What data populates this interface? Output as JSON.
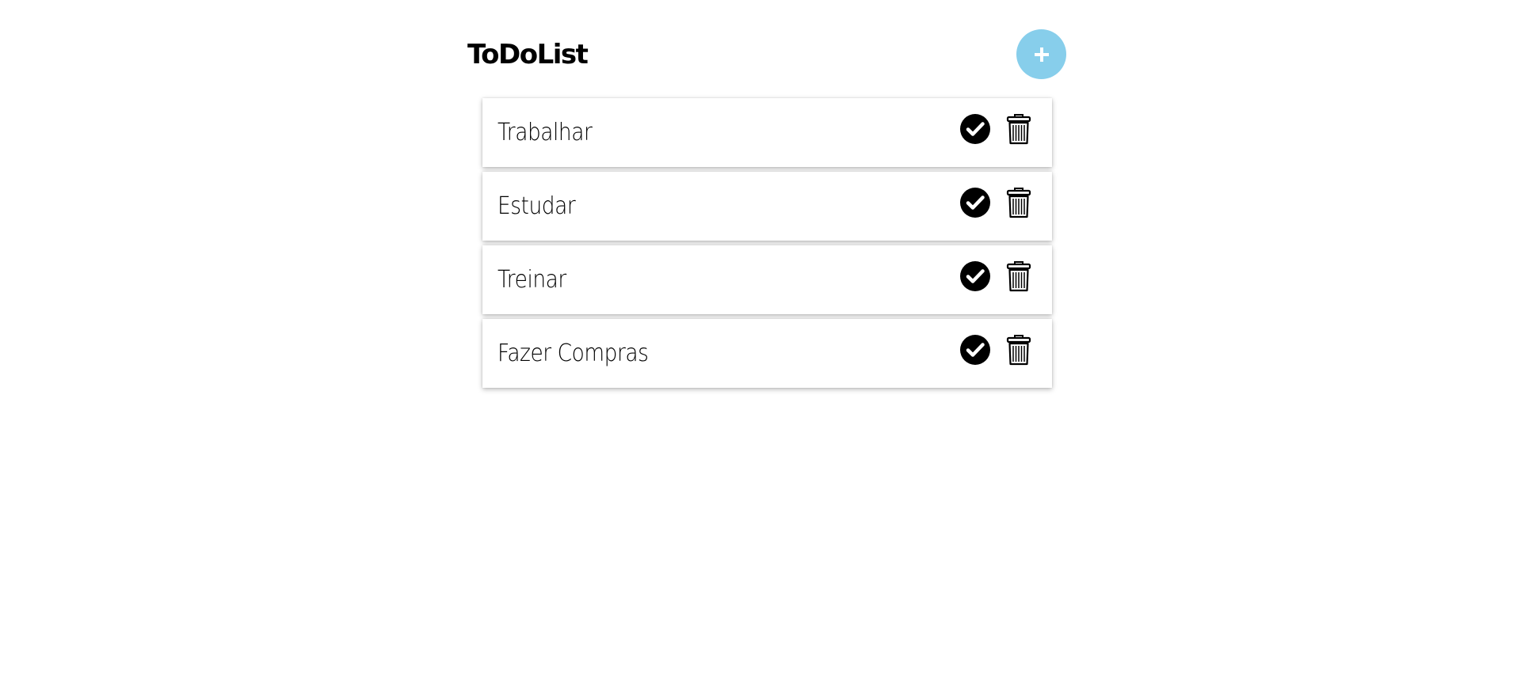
{
  "header": {
    "title": "ToDoList",
    "add_icon": "plus-icon",
    "add_button_color": "#87ceeb"
  },
  "tasks": [
    {
      "text": "Trabalhar",
      "complete_icon": "check-circle-icon",
      "delete_icon": "trash-icon"
    },
    {
      "text": "Estudar",
      "complete_icon": "check-circle-icon",
      "delete_icon": "trash-icon"
    },
    {
      "text": "Treinar",
      "complete_icon": "check-circle-icon",
      "delete_icon": "trash-icon"
    },
    {
      "text": "Fazer Compras",
      "complete_icon": "check-circle-icon",
      "delete_icon": "trash-icon"
    }
  ]
}
